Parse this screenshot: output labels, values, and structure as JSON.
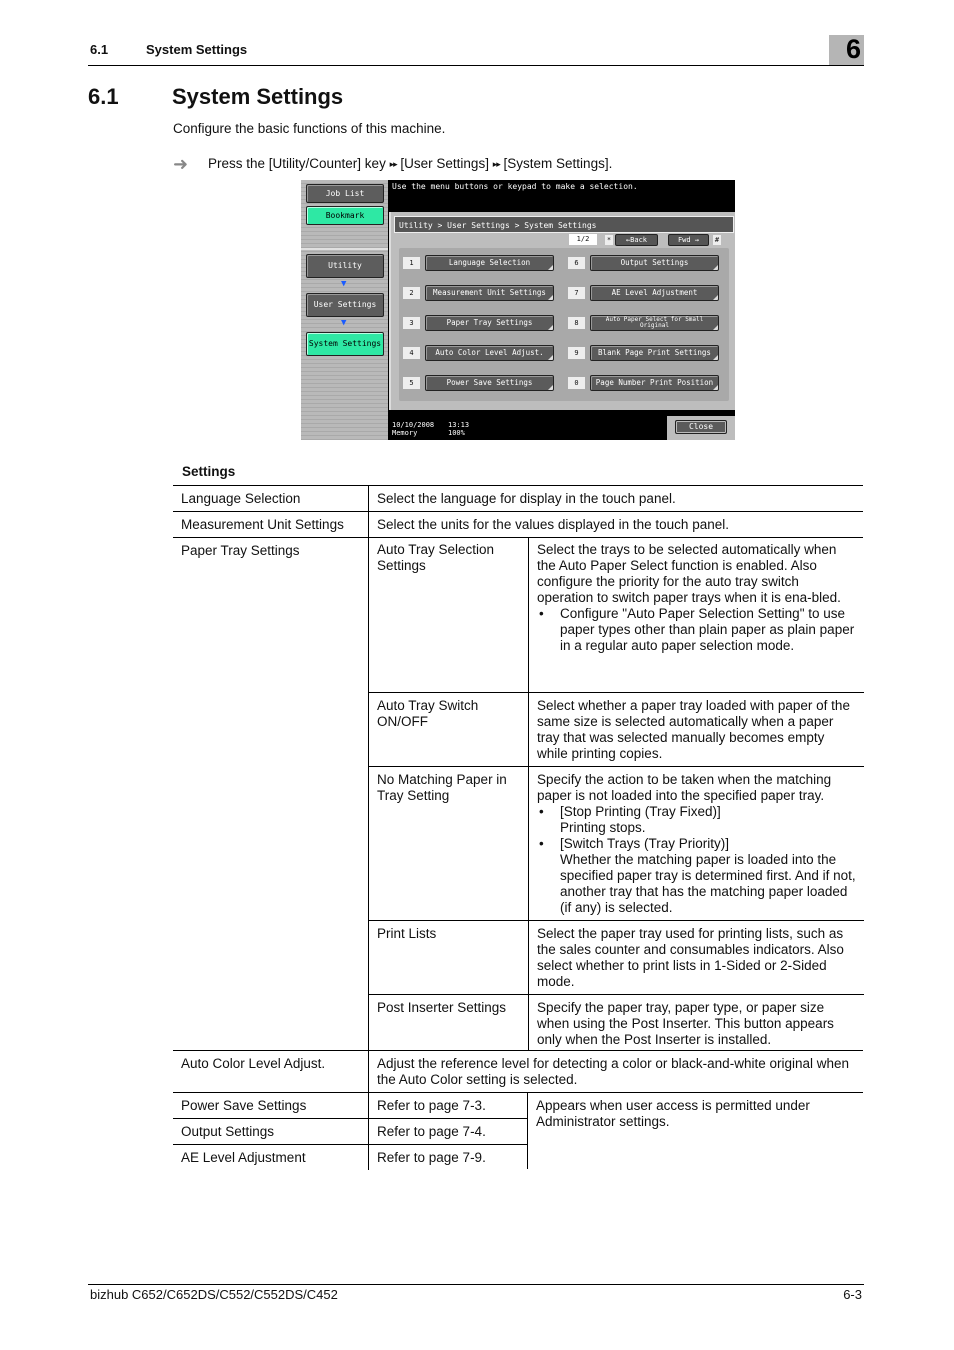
{
  "running_header": {
    "section_number": "6.1",
    "section_title": "System Settings",
    "chapter_number": "6"
  },
  "heading": {
    "number": "6.1",
    "title": "System Settings"
  },
  "intro": "Configure the basic functions of this machine.",
  "step": {
    "icon": "arrow-right-icon",
    "part1": "Press the [Utility/Counter] key",
    "sep": "▸▸",
    "part2": "[User Settings]",
    "part3": "[System Settings]."
  },
  "screen": {
    "sidebar": {
      "job_list": "Job List",
      "bookmark": "Bookmark",
      "utility": "Utility",
      "user_settings": "User Settings",
      "system_settings": "System Settings",
      "down_arrow": "▼"
    },
    "message": "Use the menu buttons or keypad to make a selection.",
    "breadcrumb": "Utility > User Settings > System Settings",
    "page_indicator": "1/2",
    "key_star": "*",
    "back_label": "←Back",
    "forward_label": "Fwd →",
    "key_hash": "#",
    "items": [
      {
        "no": "1",
        "label": "Language Selection"
      },
      {
        "no": "2",
        "label": "Measurement Unit Settings"
      },
      {
        "no": "3",
        "label": "Paper Tray Settings"
      },
      {
        "no": "4",
        "label": "Auto Color Level Adjust."
      },
      {
        "no": "5",
        "label": "Power Save Settings"
      },
      {
        "no": "6",
        "label": "Output Settings"
      },
      {
        "no": "7",
        "label": "AE Level Adjustment"
      },
      {
        "no": "8",
        "label": "Auto Paper Select for Small Original"
      },
      {
        "no": "9",
        "label": "Blank Page Print Settings"
      },
      {
        "no": "0",
        "label": "Page Number Print Position"
      }
    ],
    "status": {
      "date": "10/10/2008",
      "time": "13:13",
      "memory_label": "Memory",
      "memory_value": "100%"
    },
    "close_label": "Close",
    "colors": {
      "accent_green": "#2ee8a4",
      "arrow_blue": "#1a5cff"
    }
  },
  "table": {
    "title": "Settings",
    "rows": {
      "language": {
        "name": "Language Selection",
        "desc": "Select the language for display in the touch panel."
      },
      "measurement": {
        "name": "Measurement Unit Settings",
        "desc": "Select the units for the values displayed in the touch panel."
      },
      "paper_tray": {
        "name": "Paper Tray Settings",
        "sub": [
          {
            "name": "Auto Tray Selection Settings",
            "desc": "Select the trays to be selected automatically when the Auto Paper Select function is enabled. Also configure the priority for the auto tray switch operation to switch paper trays when it is ena-bled.",
            "bullets": [
              "Configure \"Auto Paper Selection Setting\" to use paper types other than plain paper as plain paper in a regular auto paper selection mode."
            ]
          },
          {
            "name": "Auto Tray Switch ON/OFF",
            "desc": "Select whether a paper tray loaded with paper of the same size is selected automatically when a paper tray that was selected manually becomes empty while printing copies."
          },
          {
            "name": "No Matching Paper in Tray Setting",
            "desc": "Specify the action to be taken when the matching paper is not loaded into the specified paper tray.",
            "bullets": [
              {
                "title": "[Stop Printing (Tray Fixed)]",
                "text": "Printing stops."
              },
              {
                "title": "[Switch Trays (Tray Priority)]",
                "text": "Whether the matching paper is loaded into the specified paper tray is determined first. And if not, another tray that has the matching paper loaded (if any) is selected."
              }
            ]
          },
          {
            "name": "Print Lists",
            "desc": "Select the paper tray used for printing lists, such as the sales counter and consumables indicators. Also select whether to print lists in 1-Sided or 2-Sided mode."
          },
          {
            "name": "Post Inserter Settings",
            "desc": "Specify the paper tray, paper type, or paper size when using the Post Inserter. This button appears only when the Post Inserter is installed."
          }
        ]
      },
      "auto_color": {
        "name": "Auto Color Level Adjust.",
        "desc": "Adjust the reference level for detecting a color or black-and-white original when the Auto Color setting is selected."
      },
      "power_save": {
        "name": "Power Save Settings",
        "ref": "Refer to page 7-3."
      },
      "output": {
        "name": "Output Settings",
        "ref": "Refer to page 7-4."
      },
      "ae_level": {
        "name": "AE Level Adjustment",
        "ref": "Refer to page 7-9."
      },
      "shared_note": "Appears when user access is permitted under Administrator settings."
    }
  },
  "footer": {
    "product": "bizhub C652/C652DS/C552/C552DS/C452",
    "page": "6-3"
  }
}
